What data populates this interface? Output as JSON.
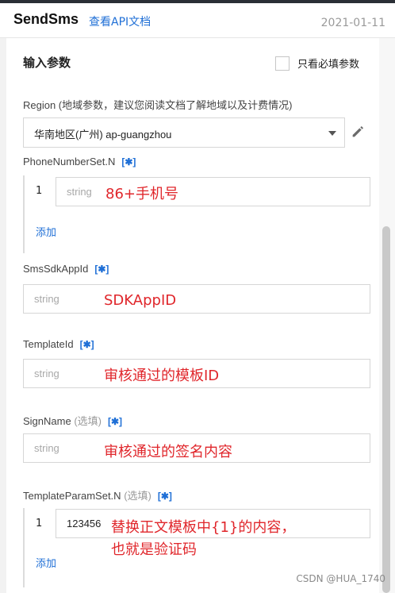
{
  "header": {
    "title": "SendSms",
    "doc_link": "查看API文档",
    "date": "2021-01-11"
  },
  "section": {
    "title": "输入参数",
    "only_required_label": "只看必填参数"
  },
  "required_badge": "[✱]",
  "optional_text": "(选填)",
  "fields": {
    "region": {
      "label": "Region (地域参数，建议您阅读文档了解地域以及计费情况)",
      "value": "华南地区(广州) ap-guangzhou"
    },
    "phone": {
      "label": "PhoneNumberSet.N",
      "index": "1",
      "placeholder": "string",
      "annotation": "86+手机号",
      "add_label": "添加"
    },
    "sdk_app_id": {
      "label": "SmsSdkAppId",
      "placeholder": "string",
      "annotation": "SDKAppID"
    },
    "template_id": {
      "label": "TemplateId",
      "placeholder": "string",
      "annotation": "审核通过的模板ID"
    },
    "sign_name": {
      "label": "SignName",
      "placeholder": "string",
      "annotation": "审核通过的签名内容"
    },
    "template_param": {
      "label": "TemplateParamSet.N",
      "index": "1",
      "value": "123456",
      "annotation_line1": "替换正文模板中{1}的内容，",
      "annotation_line2": "也就是验证码",
      "add_label": "添加"
    }
  },
  "watermark": "CSDN @HUA_1740",
  "icons": {
    "edit": "pencil-icon",
    "dropdown": "chevron-down-icon"
  }
}
